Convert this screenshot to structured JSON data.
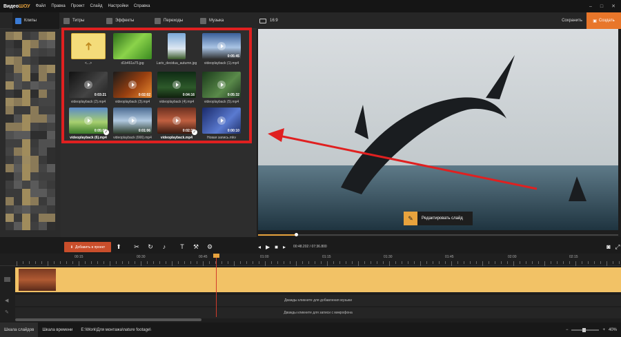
{
  "app": {
    "logo_a": "Видео",
    "logo_b": "ШОУ"
  },
  "menu": [
    "Файл",
    "Правка",
    "Проект",
    "Слайд",
    "Настройки",
    "Справка"
  ],
  "window_controls": [
    "–",
    "□",
    "✕"
  ],
  "tabs": [
    {
      "label": "Клипы",
      "active": true
    },
    {
      "label": "Титры"
    },
    {
      "label": "Эффекты"
    },
    {
      "label": "Переходы"
    },
    {
      "label": "Музыка"
    }
  ],
  "preview_header": {
    "ratio": "16:9",
    "save": "Сохранить",
    "create": "Создать"
  },
  "files": [
    {
      "name": "<...>",
      "duration": "",
      "kind": "folder-up",
      "bold": false,
      "checked": false
    },
    {
      "name": "d1b461a75.jpg",
      "duration": "",
      "kind": "image-grass",
      "bold": false,
      "checked": false
    },
    {
      "name": "Larix_decidua_autumn.jpg",
      "duration": "",
      "kind": "image-tree",
      "bold": false,
      "checked": false
    },
    {
      "name": "videoplayback (1).mp4",
      "duration": "0:05:45",
      "kind": "video-sky",
      "bold": false,
      "checked": false
    },
    {
      "name": "videoplayback (2).mp4",
      "duration": "0:03:21",
      "kind": "video-dark",
      "bold": false,
      "checked": false
    },
    {
      "name": "videoplayback (3).mp4",
      "duration": "0:02:02",
      "kind": "video-fire",
      "bold": false,
      "checked": false
    },
    {
      "name": "videoplayback (4).mp4",
      "duration": "0:04:16",
      "kind": "video-forest",
      "bold": false,
      "checked": false
    },
    {
      "name": "videoplayback (5).mp4",
      "duration": "0:05:32",
      "kind": "video-green",
      "bold": false,
      "checked": false
    },
    {
      "name": "videoplayback (6).mp4",
      "duration": "0:05:09",
      "kind": "video-field",
      "bold": true,
      "checked": true
    },
    {
      "name": "videoplayback (666).mp4",
      "duration": "0:01:06",
      "kind": "video-mountain",
      "bold": false,
      "checked": false
    },
    {
      "name": "videoplayback.mp4",
      "duration": "0:02:30",
      "kind": "video-sunset",
      "bold": true,
      "checked": true
    },
    {
      "name": "Новая запись.mkv",
      "duration": "0:00:10",
      "kind": "video-blue",
      "bold": false,
      "checked": false
    }
  ],
  "preview": {
    "edit_button": "Редактировать слайд",
    "progress": 0.107
  },
  "toolbar": {
    "add_to_project": "Добавить в проект"
  },
  "player": {
    "timecode": "00:48.202 / 07:36.800"
  },
  "timeline": {
    "ticks": [
      "00:15",
      "00:30",
      "00:45",
      "01:00",
      "01:15",
      "01:30",
      "01:45",
      "02:00",
      "02:15"
    ],
    "music_hint": "Дважды кликните для добавления музыки",
    "mic_hint": "Дважды кликните для записи с микрофона"
  },
  "status": {
    "tab_slides": "Шкала слайдов",
    "tab_timeline": "Шкала времени",
    "path": "E:\\Work\\Для монтажа\\nature footage\\",
    "zoom": "40%"
  },
  "colors": {
    "accent": "#e8a33d",
    "create": "#e8762a",
    "highlight": "#e02020"
  }
}
